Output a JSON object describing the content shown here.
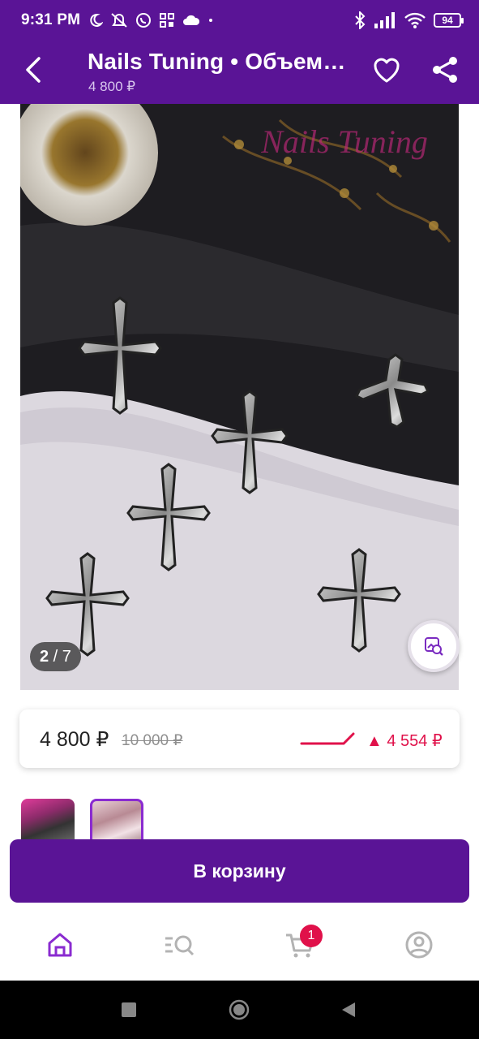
{
  "status_bar": {
    "time": "9:31 PM",
    "battery": "94",
    "icons_left": [
      "moon-icon",
      "mute-icon",
      "whatsapp-icon",
      "grid-icon",
      "cloud-icon",
      "dot-icon"
    ],
    "icons_right": [
      "bluetooth-icon",
      "signal-icon",
      "wifi-icon",
      "battery-icon"
    ]
  },
  "app_bar": {
    "title": "Nails Tuning • Объемный декор",
    "subtitle": "4 800 ₽",
    "back_icon": "back-arrow-icon",
    "favorite_icon": "heart-icon",
    "share_icon": "share-icon"
  },
  "gallery": {
    "counter_current": "2",
    "counter_separator": " / ",
    "counter_total": "7",
    "watermark": "Nails Tuning",
    "zoom_icon": "image-search-icon"
  },
  "price": {
    "current": "4 800 ₽",
    "old": "10 000 ₽",
    "delta_arrow": "▲",
    "delta_value": "4 554 ₽",
    "accent": "#e0114a"
  },
  "thumbnails": [
    {
      "selected": false
    },
    {
      "selected": true
    }
  ],
  "cart_button": {
    "label": "В корзину"
  },
  "bottom_nav": {
    "items": [
      {
        "icon": "home-icon",
        "active": true
      },
      {
        "icon": "catalog-search-icon",
        "active": false
      },
      {
        "icon": "cart-icon",
        "active": false,
        "badge": "1"
      },
      {
        "icon": "profile-icon",
        "active": false
      }
    ]
  },
  "colors": {
    "brand": "#5a1496",
    "accent": "#e0114a",
    "active_nav": "#8a2bd0",
    "inactive_nav": "#b3b3b3"
  }
}
